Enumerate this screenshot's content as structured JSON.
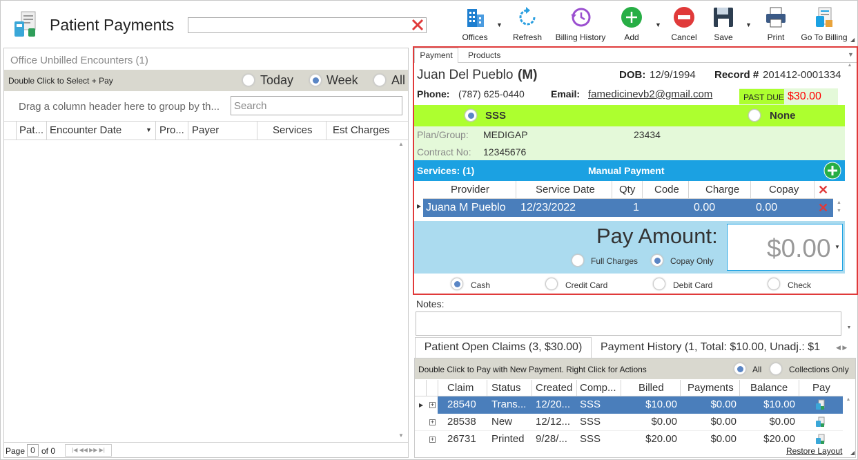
{
  "header": {
    "title": "Patient Payments",
    "search_value": ""
  },
  "toolbar": {
    "offices": "Offices",
    "refresh": "Refresh",
    "billing_history": "Billing History",
    "add": "Add",
    "cancel": "Cancel",
    "save": "Save",
    "print": "Print",
    "go_to_billing": "Go To Billing"
  },
  "left": {
    "title": "Office Unbilled Encounters (1)",
    "hint": "Double Click to Select + Pay",
    "range_options": [
      "Today",
      "Week",
      "All"
    ],
    "range_selected": "Week",
    "group_hint": "Drag a column header here to group by th...",
    "search_placeholder": "Search",
    "columns": [
      "Pat...",
      "Encounter Date",
      "Pro...",
      "Payer",
      "Services",
      "Est Charges"
    ],
    "pager": {
      "page_label": "Page",
      "page": "0",
      "of_label": "of 0"
    }
  },
  "payment": {
    "tabs": [
      "Payment",
      "Products"
    ],
    "patient_name": "Juan Del Pueblo",
    "gender": "(M)",
    "dob_label": "DOB:",
    "dob": "12/9/1994",
    "record_label": "Record #",
    "record": "201412-0001334",
    "phone_label": "Phone:",
    "phone": "(787) 625-0440",
    "email_label": "Email:",
    "email": "famedicinevb2@gmail.com",
    "past_due_label": "PAST DUE",
    "past_due_amount": "$30.00",
    "insurance_options": [
      "SSS",
      "None"
    ],
    "insurance_selected": "SSS",
    "plan_label": "Plan/Group:",
    "plan": "MEDIGAP",
    "group": "23434",
    "contract_label": "Contract No:",
    "contract": "12345676",
    "services_label": "Services: (1)",
    "manual_payment": "Manual Payment",
    "service_columns": [
      "Provider",
      "Service Date",
      "Qty",
      "Code",
      "Charge",
      "Copay"
    ],
    "services": [
      {
        "provider": "Juana M Pueblo",
        "date": "12/23/2022",
        "qty": "1",
        "code": "",
        "charge": "0.00",
        "copay": "0.00"
      }
    ],
    "pay_amount_label": "Pay Amount:",
    "pay_amount": "$0.00",
    "charge_options": [
      "Full Charges",
      "Copay Only"
    ],
    "charge_selected": "Copay Only",
    "methods": [
      "Cash",
      "Credit Card",
      "Debit Card",
      "Check"
    ],
    "method_selected": "Cash"
  },
  "notes": {
    "label": "Notes:",
    "value": ""
  },
  "claims": {
    "tabs": [
      "Patient Open Claims (3, $30.00)",
      "Payment History (1, Total: $10.00, Unadj.: $1"
    ],
    "hint": "Double Click to Pay with New Payment. Right Click for Actions",
    "filter_options": [
      "All",
      "Collections Only"
    ],
    "filter_selected": "All",
    "columns": [
      "Claim",
      "Status",
      "Created",
      "Comp...",
      "Billed",
      "Payments",
      "Balance",
      "Pay"
    ],
    "rows": [
      {
        "claim": "28540",
        "status": "Trans...",
        "created": "12/20...",
        "comp": "SSS",
        "billed": "$10.00",
        "payments": "$0.00",
        "balance": "$10.00"
      },
      {
        "claim": "28538",
        "status": "New",
        "created": "12/12...",
        "comp": "SSS",
        "billed": "$0.00",
        "payments": "$0.00",
        "balance": "$0.00"
      },
      {
        "claim": "26731",
        "status": "Printed",
        "created": "9/28/...",
        "comp": "SSS",
        "billed": "$20.00",
        "payments": "$0.00",
        "balance": "$20.00"
      }
    ],
    "restore_layout": "Restore Layout"
  },
  "colors": {
    "accent_blue": "#1ba1e2",
    "selected_row": "#4a7ebb",
    "insurance_green": "#adff2f",
    "light_green": "#e4f9d9",
    "pay_blue": "#abdbef",
    "past_due_red": "#ff0000",
    "frame_red": "#e03a3a"
  }
}
